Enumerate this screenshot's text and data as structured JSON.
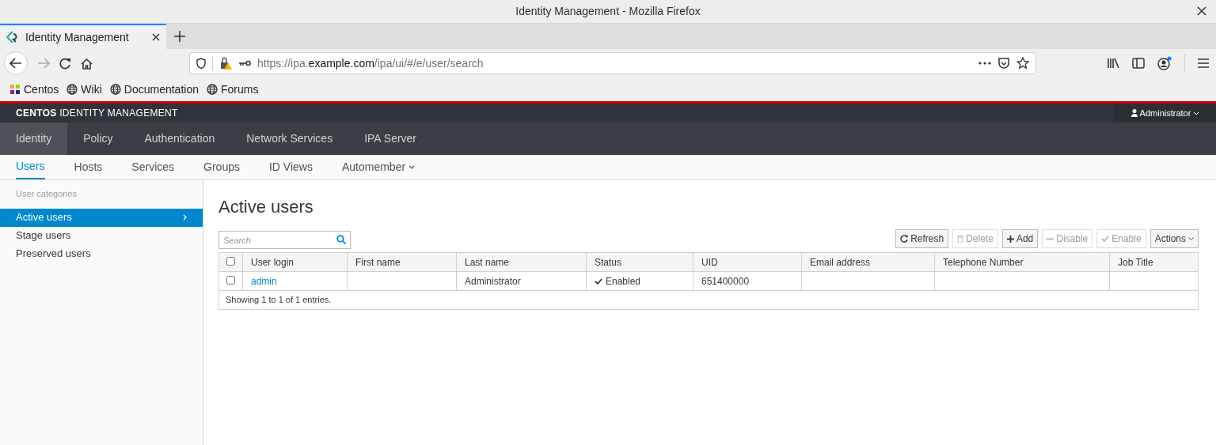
{
  "window": {
    "title": "Identity Management - Mozilla Firefox"
  },
  "browser": {
    "tabs": [
      {
        "label": "Identity Management",
        "selected": true
      }
    ],
    "url": "https://ipa.**example.com**/ipa/ui/#/e/user/search",
    "bookmarks": [
      {
        "label": "Centos",
        "kind": "logo"
      },
      {
        "label": "Wiki",
        "kind": "globe"
      },
      {
        "label": "Documentation",
        "kind": "globe"
      },
      {
        "label": "Forums",
        "kind": "globe"
      }
    ]
  },
  "masthead": {
    "brand": "**CENTOS** IDENTITY MANAGEMENT",
    "user": "Administrator"
  },
  "nav": [
    {
      "label": "Identity",
      "selected": true
    },
    {
      "label": "Policy",
      "selected": false
    },
    {
      "label": "Authentication",
      "selected": false
    },
    {
      "label": "Network Services",
      "selected": false
    },
    {
      "label": "IPA Server",
      "selected": false
    }
  ],
  "subnav": [
    {
      "label": "Users",
      "selected": true,
      "dropdown": false
    },
    {
      "label": "Hosts",
      "selected": false,
      "dropdown": false
    },
    {
      "label": "Services",
      "selected": false,
      "dropdown": false
    },
    {
      "label": "Groups",
      "selected": false,
      "dropdown": false
    },
    {
      "label": "ID Views",
      "selected": false,
      "dropdown": false
    },
    {
      "label": "Automember",
      "selected": false,
      "dropdown": true
    }
  ],
  "sidebar": {
    "heading": "User categories",
    "items": [
      {
        "label": "Active users",
        "selected": true
      },
      {
        "label": "Stage users",
        "selected": false
      },
      {
        "label": "Preserved users",
        "selected": false
      }
    ]
  },
  "content": {
    "title": "Active users",
    "search": {
      "placeholder": "Search"
    },
    "buttons": [
      {
        "label": "Refresh",
        "kind": "refresh",
        "disabled": false
      },
      {
        "label": "Delete",
        "kind": "delete",
        "disabled": true
      },
      {
        "label": "Add",
        "kind": "add",
        "disabled": false
      },
      {
        "label": "Disable",
        "kind": "disable",
        "disabled": true
      },
      {
        "label": "Enable",
        "kind": "enable",
        "disabled": true
      },
      {
        "label": "Actions",
        "kind": "dropdown",
        "disabled": false
      }
    ],
    "table": {
      "header_checked": false,
      "columns": [
        "User login",
        "First name",
        "Last name",
        "Status",
        "UID",
        "Email address",
        "Telephone Number",
        "Job Title"
      ],
      "rows": [
        {
          "checked": false,
          "cells": [
            "admin",
            "",
            "Administrator",
            "Enabled",
            "651400000",
            "",
            "",
            ""
          ]
        }
      ],
      "footer": "Showing 1 to 1 of 1 entries."
    }
  }
}
